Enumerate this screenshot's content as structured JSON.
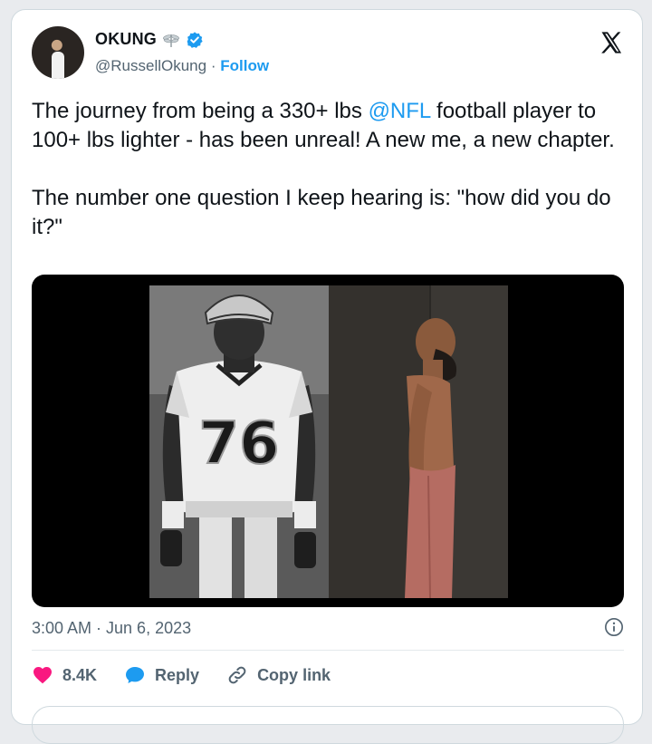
{
  "tweet": {
    "author": {
      "display_name": "OKUNG",
      "handle": "@RussellOkung",
      "follow_label": "Follow",
      "separator": "·",
      "avatar_icon": "profile-photo",
      "badge_icon": "dragonfly-icon",
      "verified_icon": "verified-badge-icon",
      "verified_color": "#1d9bf0"
    },
    "text": {
      "part1": "The journey from being a 330+ lbs ",
      "mention": "@NFL",
      "part2": " football player to 100+ lbs lighter - has been unreal! A new me, a new chapter.\n\nThe number one question I keep hearing is: \"how did you do it?\""
    },
    "media": {
      "left_photo": {
        "jersey_number": "76"
      }
    },
    "timestamp": "3:00 AM · Jun 6, 2023",
    "actions": {
      "like_count": "8.4K",
      "reply_label": "Reply",
      "copy_link_label": "Copy link"
    },
    "colors": {
      "accent": "#1d9bf0",
      "like": "#f91880",
      "text": "#0f1419",
      "muted": "#536471"
    }
  }
}
